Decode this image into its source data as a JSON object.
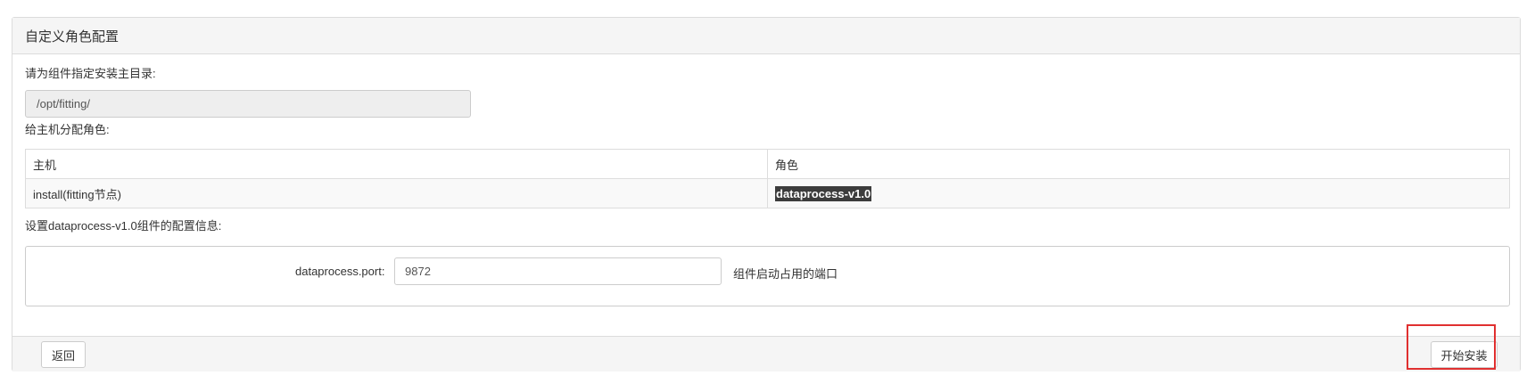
{
  "panel": {
    "title": "自定义角色配置"
  },
  "install_dir": {
    "label": "请为组件指定安装主目录:",
    "value": "/opt/fitting/"
  },
  "role_assignment": {
    "label": "给主机分配角色:",
    "columns": [
      "主机",
      "角色"
    ],
    "rows": [
      {
        "host": "install(fitting节点)",
        "role": "dataprocess-v1.0"
      }
    ]
  },
  "config": {
    "label": "设置dataprocess-v1.0组件的配置信息:",
    "port_label": "dataprocess.port:",
    "port_value": "9872",
    "port_help": "组件启动占用的端口"
  },
  "footer": {
    "back_label": "返回",
    "install_label": "开始安装"
  },
  "colors": {
    "highlight_outline": "#e03030",
    "panel_header_bg": "#f5f5f5"
  }
}
